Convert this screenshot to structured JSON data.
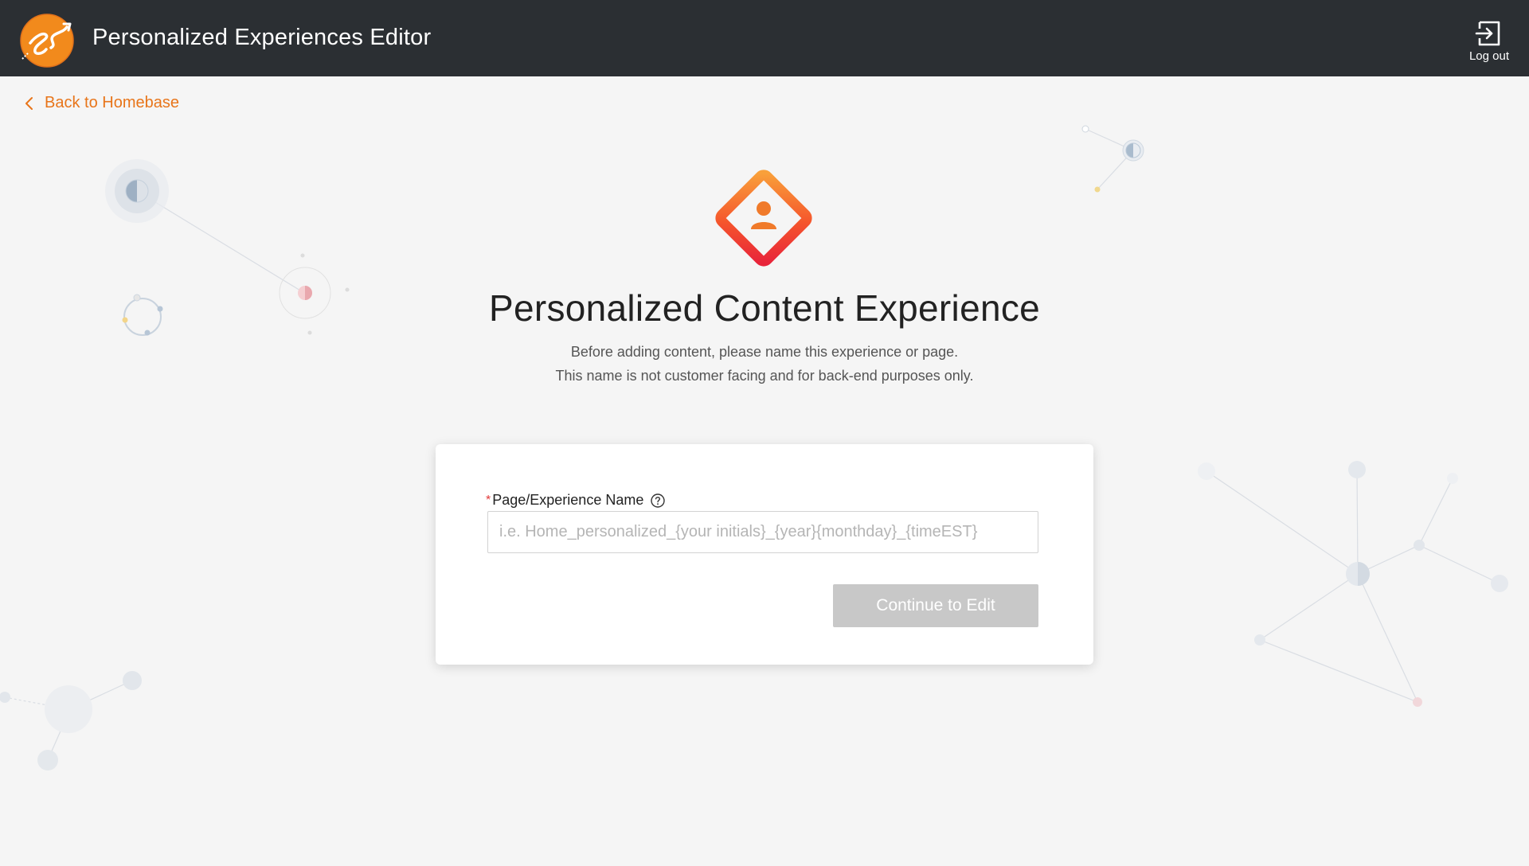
{
  "header": {
    "app_title": "Personalized Experiences Editor",
    "logo_icon": "es-logo-icon",
    "logout_label": "Log out",
    "logout_icon": "logout-icon"
  },
  "nav": {
    "back_label": "Back to Homebase",
    "back_icon": "chevron-left-icon"
  },
  "hero": {
    "icon": "user-diamond-icon",
    "title": "Personalized Content Experience",
    "subtitle_line1": "Before adding content, please name this experience or page.",
    "subtitle_line2": "This name is not customer facing and for back-end purposes only."
  },
  "form": {
    "required_marker": "*",
    "name_label": "Page/Experience Name",
    "help_icon": "question-circle-icon",
    "name_placeholder": "i.e. Home_personalized_{your initials}_{year}{monthday}_{timeEST}",
    "name_value": "",
    "continue_label": "Continue to Edit",
    "continue_enabled": false
  },
  "colors": {
    "topbar": "#2b2f33",
    "accent": "#e8751a",
    "background": "#f5f5f5",
    "disabled_button": "#c8c8c8"
  }
}
